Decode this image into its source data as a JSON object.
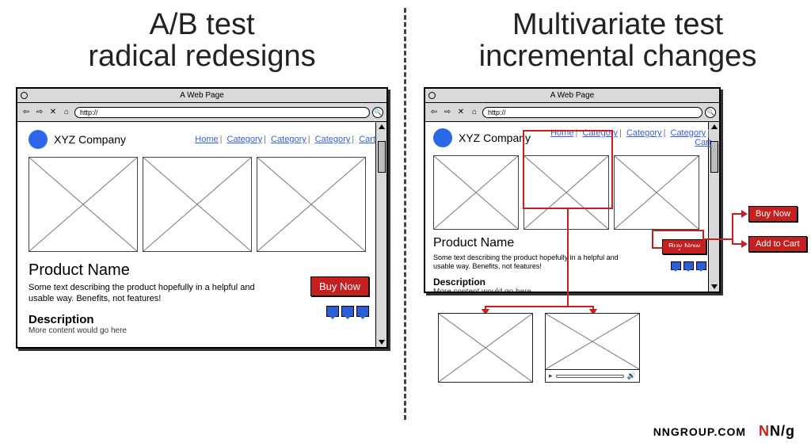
{
  "section_left_title": "A/B test\nradical redesigns",
  "section_right_title": "Multivariate test\nincremental changes",
  "browser": {
    "titlebar": "A Web Page",
    "url": "http://",
    "company": "XYZ Company",
    "nav": [
      "Home",
      "Category",
      "Category",
      "Category",
      "Cart"
    ],
    "product_name": "Product Name",
    "body_text": "Some text describing the product hopefully in a helpful and usable way. Benefits, not features!",
    "description_heading": "Description",
    "description_more": "More content would go here",
    "buy_button": "Buy Now"
  },
  "variant_buttons": [
    "Buy Now",
    "Add to Cart"
  ],
  "footer": {
    "site": "NNGROUP.COM",
    "logo_text": "NN/g"
  }
}
